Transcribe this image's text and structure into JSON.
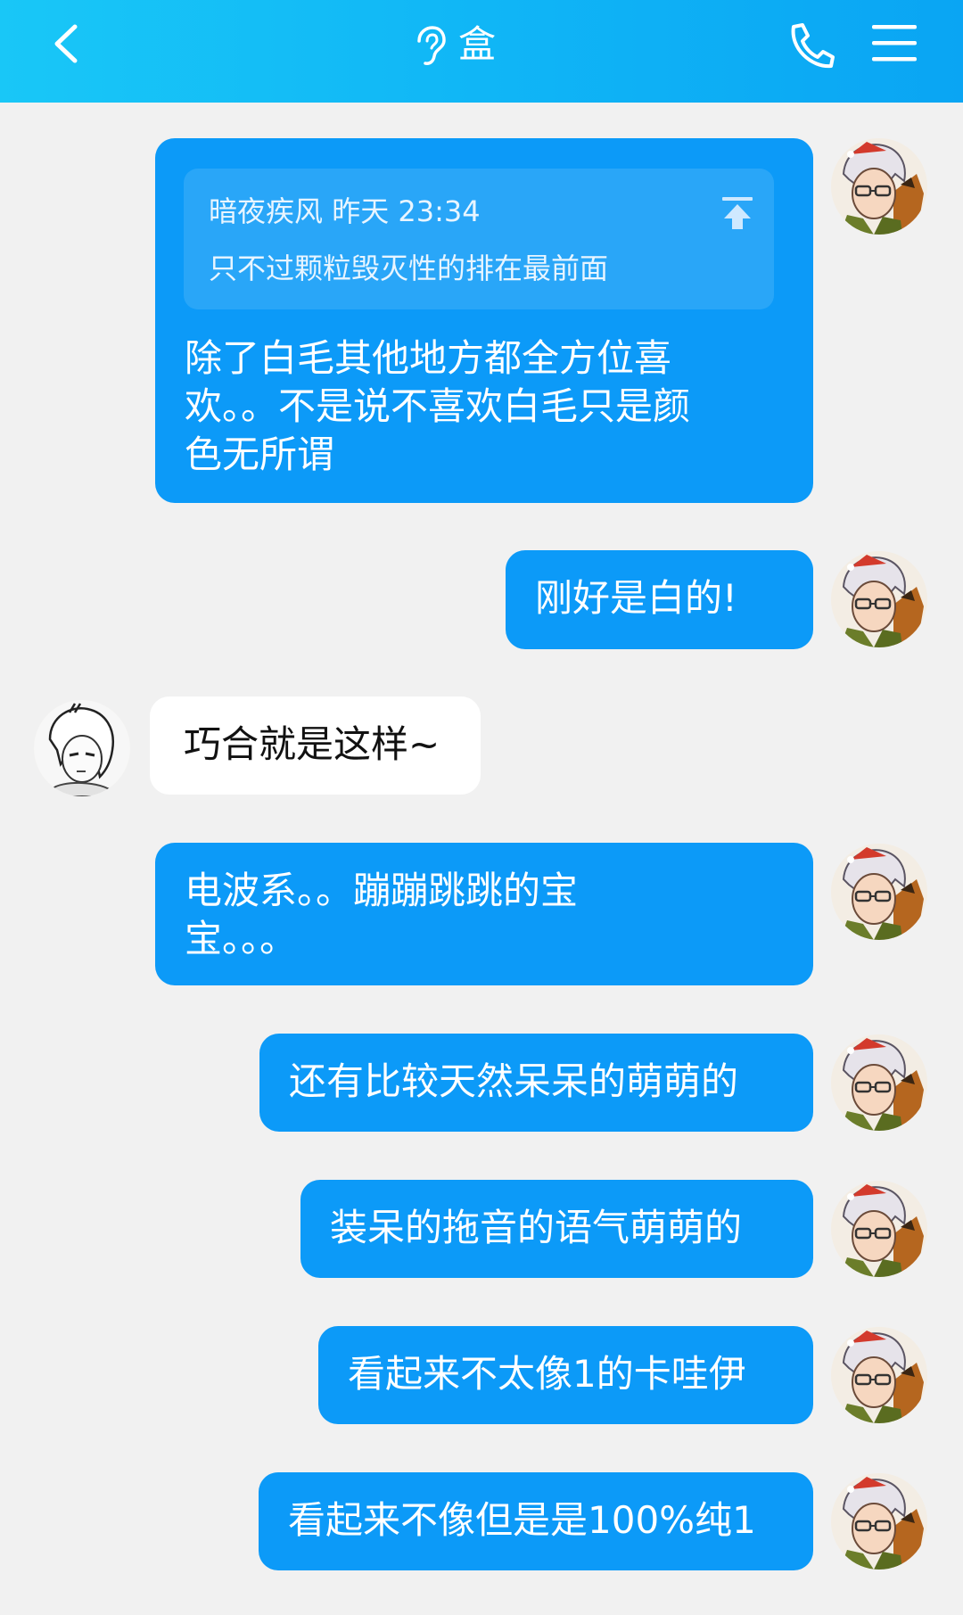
{
  "header": {
    "title": "盒",
    "icons": [
      "back-icon",
      "ear-icon",
      "phone-icon",
      "menu-icon"
    ]
  },
  "messages": [
    {
      "side": "me",
      "quote": {
        "sender": "暗夜疾风",
        "time": "昨天 23:34",
        "text": "只不过颗粒毁灭性的排在最前面"
      },
      "lines": [
        "除了白毛其他地方都全方位喜",
        "欢。。不是说不喜欢白毛只是颜",
        "色无所谓"
      ]
    },
    {
      "side": "me",
      "lines": [
        "刚好是白的!"
      ]
    },
    {
      "side": "other",
      "lines": [
        "巧合就是这样~"
      ]
    },
    {
      "side": "me",
      "lines": [
        "电波系。。蹦蹦跳跳的宝",
        "宝。。。"
      ]
    },
    {
      "side": "me",
      "lines": [
        "还有比较天然呆呆的萌萌的"
      ]
    },
    {
      "side": "me",
      "lines": [
        "装呆的拖音的语气萌萌的"
      ]
    },
    {
      "side": "me",
      "lines": [
        "看起来不太像1的卡哇伊"
      ]
    },
    {
      "side": "me",
      "lines": [
        "看起来不像但是是100%纯1"
      ]
    }
  ],
  "colors": {
    "header_gradient_start": "#19c7f7",
    "header_gradient_end": "#0aa5f3",
    "outgoing_bubble": "#0c9af8",
    "incoming_bubble": "#ffffff",
    "background": "#f1f1f1"
  }
}
